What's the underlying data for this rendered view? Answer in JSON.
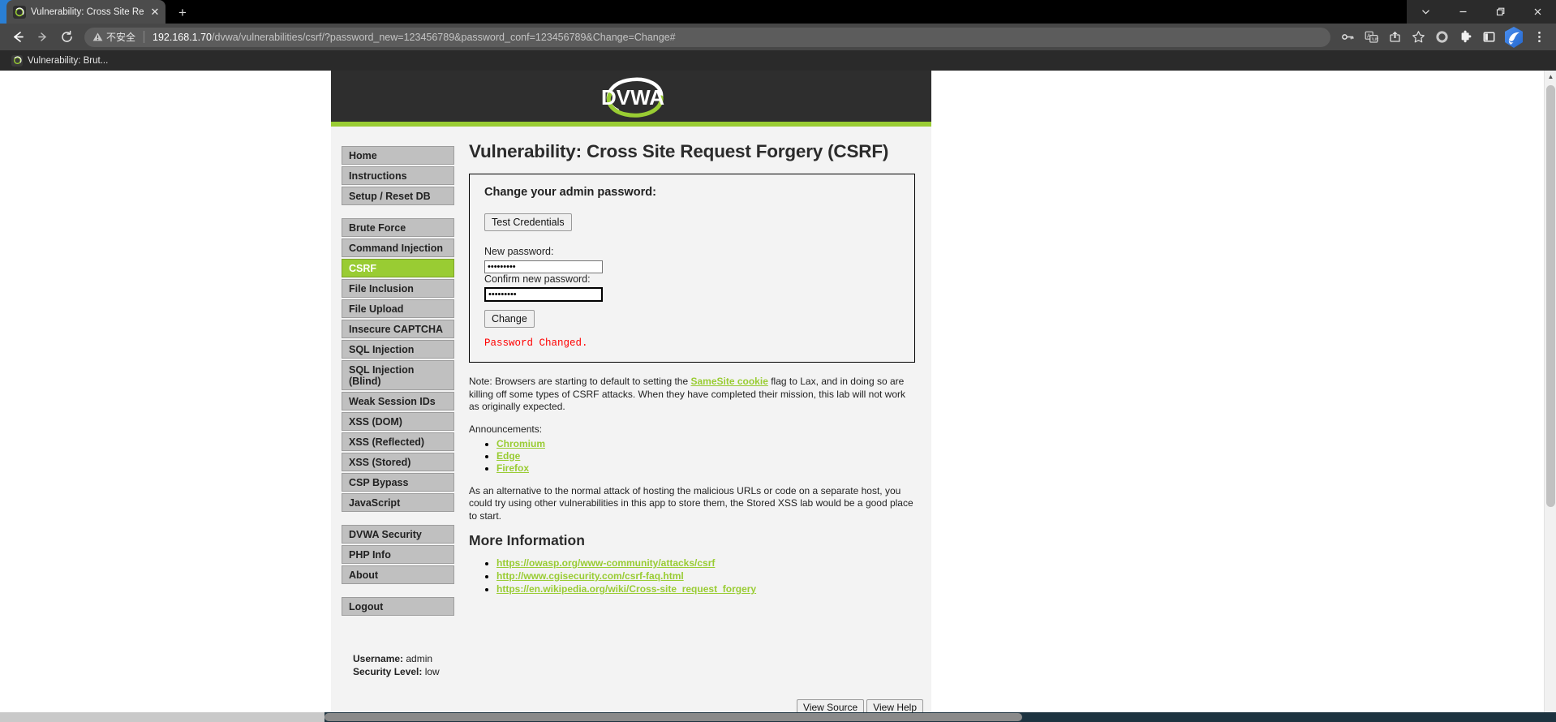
{
  "browser": {
    "tab": {
      "title": "Vulnerability: Cross Site Reque",
      "favicon_name": "dvwa-favicon",
      "close_label": "✕"
    },
    "new_tab_label": "+",
    "window_controls": {
      "minimize_group": "⌄",
      "minimize": "—",
      "maximize": "❐",
      "close": "✕"
    },
    "nav": {
      "back": "←",
      "forward": "→",
      "reload": "↻"
    },
    "omnibox": {
      "security_text": "不安全",
      "url_host": "192.168.1.70",
      "url_path": "/dvwa/vulnerabilities/csrf/?password_new=123456789&password_conf=123456789&Change=Change#",
      "full_url": "192.168.1.70/dvwa/vulnerabilities/csrf/?password_new=123456789&password_conf=123456789&Change=Change#"
    },
    "toolbar_icons": [
      "key-icon",
      "translate-icon",
      "share-icon",
      "star-icon",
      "profile-icon",
      "extensions-icon",
      "sidebar-icon",
      "bird-avatar-icon",
      "menu-kebab-icon"
    ],
    "bookmarks": [
      {
        "label": "Vulnerability: Brut..."
      }
    ]
  },
  "page": {
    "logo_text": "DVWA",
    "title": "Vulnerability: Cross Site Request Forgery (CSRF)",
    "sidebar": {
      "group1": [
        {
          "label": "Home",
          "active": false
        },
        {
          "label": "Instructions",
          "active": false
        },
        {
          "label": "Setup / Reset DB",
          "active": false
        }
      ],
      "group2": [
        {
          "label": "Brute Force",
          "active": false
        },
        {
          "label": "Command Injection",
          "active": false
        },
        {
          "label": "CSRF",
          "active": true
        },
        {
          "label": "File Inclusion",
          "active": false
        },
        {
          "label": "File Upload",
          "active": false
        },
        {
          "label": "Insecure CAPTCHA",
          "active": false
        },
        {
          "label": "SQL Injection",
          "active": false
        },
        {
          "label": "SQL Injection (Blind)",
          "active": false
        },
        {
          "label": "Weak Session IDs",
          "active": false
        },
        {
          "label": "XSS (DOM)",
          "active": false
        },
        {
          "label": "XSS (Reflected)",
          "active": false
        },
        {
          "label": "XSS (Stored)",
          "active": false
        },
        {
          "label": "CSP Bypass",
          "active": false
        },
        {
          "label": "JavaScript",
          "active": false
        }
      ],
      "group3": [
        {
          "label": "DVWA Security",
          "active": false
        },
        {
          "label": "PHP Info",
          "active": false
        },
        {
          "label": "About",
          "active": false
        }
      ],
      "group4": [
        {
          "label": "Logout",
          "active": false
        }
      ]
    },
    "form": {
      "heading": "Change your admin password:",
      "test_credentials_label": "Test Credentials",
      "new_password_label": "New password:",
      "new_password_value": "•••••••••",
      "confirm_password_label": "Confirm new password:",
      "confirm_password_value": "•••••••••",
      "change_button_label": "Change",
      "result_message": "Password Changed.",
      "result_color": "#ff0000"
    },
    "note": {
      "part1": "Note: Browsers are starting to default to setting the ",
      "link": "SameSite cookie",
      "part2": " flag to Lax, and in doing so are killing off some types of CSRF attacks. When they have completed their mission, this lab will not work as originally expected."
    },
    "announcements_label": "Announcements:",
    "announcement_links": [
      {
        "label": "Chromium"
      },
      {
        "label": "Edge"
      },
      {
        "label": "Firefox"
      }
    ],
    "alternative_text": "As an alternative to the normal attack of hosting the malicious URLs or code on a separate host, you could try using other vulnerabilities in this app to store them, the Stored XSS lab would be a good place to start.",
    "more_information_heading": "More Information",
    "more_information_links": [
      {
        "label": "https://owasp.org/www-community/attacks/csrf"
      },
      {
        "label": "http://www.cgisecurity.com/csrf-faq.html"
      },
      {
        "label": "https://en.wikipedia.org/wiki/Cross-site_request_forgery"
      }
    ],
    "footer": {
      "username_label": "Username:",
      "username_value": "admin",
      "security_level_label": "Security Level:",
      "security_level_value": "low"
    },
    "view_buttons": {
      "view_source": "View Source",
      "view_help": "View Help"
    },
    "colors": {
      "accent_green": "#9c3",
      "header_dark": "#2e2e2e",
      "menu_gray": "#c0c0c0",
      "error_red": "#ff0000"
    }
  }
}
